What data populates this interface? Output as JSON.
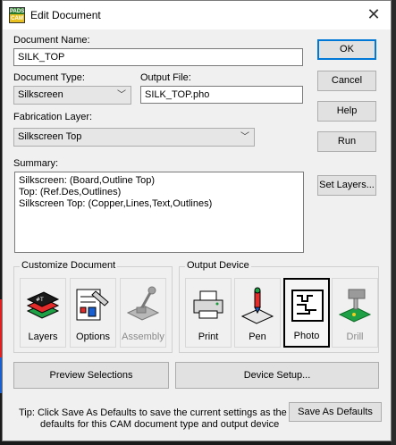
{
  "window": {
    "title": "Edit Document",
    "icon": "pads-cam-icon"
  },
  "fields": {
    "document_name_label": "Document Name:",
    "document_name_value": "SILK_TOP",
    "document_type_label": "Document Type:",
    "document_type_value": "Silkscreen",
    "output_file_label": "Output File:",
    "output_file_value": "SILK_TOP.pho",
    "fabrication_layer_label": "Fabrication Layer:",
    "fabrication_layer_value": "Silkscreen Top",
    "summary_label": "Summary:",
    "summary_lines": [
      "Silkscreen: (Board,Outline Top)",
      "Top: (Ref.Des,Outlines)",
      "Silkscreen Top: (Copper,Lines,Text,Outlines)"
    ]
  },
  "side_buttons": {
    "ok": "OK",
    "cancel": "Cancel",
    "help": "Help",
    "run": "Run",
    "set_layers": "Set Layers..."
  },
  "customize": {
    "title": "Customize Document",
    "items": [
      {
        "label": "Layers",
        "icon": "layers-icon",
        "enabled": true
      },
      {
        "label": "Options",
        "icon": "options-icon",
        "enabled": true
      },
      {
        "label": "Assembly",
        "icon": "assembly-icon",
        "enabled": false
      }
    ]
  },
  "output_device": {
    "title": "Output Device",
    "items": [
      {
        "label": "Print",
        "icon": "printer-icon",
        "enabled": true,
        "selected": false
      },
      {
        "label": "Pen",
        "icon": "pen-plotter-icon",
        "enabled": true,
        "selected": false
      },
      {
        "label": "Photo",
        "icon": "photo-plotter-icon",
        "enabled": true,
        "selected": true
      },
      {
        "label": "Drill",
        "icon": "drill-icon",
        "enabled": false,
        "selected": false
      }
    ]
  },
  "bottom_buttons": {
    "preview": "Preview Selections",
    "device_setup": "Device Setup...",
    "save_defaults": "Save As Defaults"
  },
  "tip": {
    "line1": "Tip: Click Save As Defaults to save the current settings as the",
    "line2": "defaults for this CAM document type and output device"
  }
}
